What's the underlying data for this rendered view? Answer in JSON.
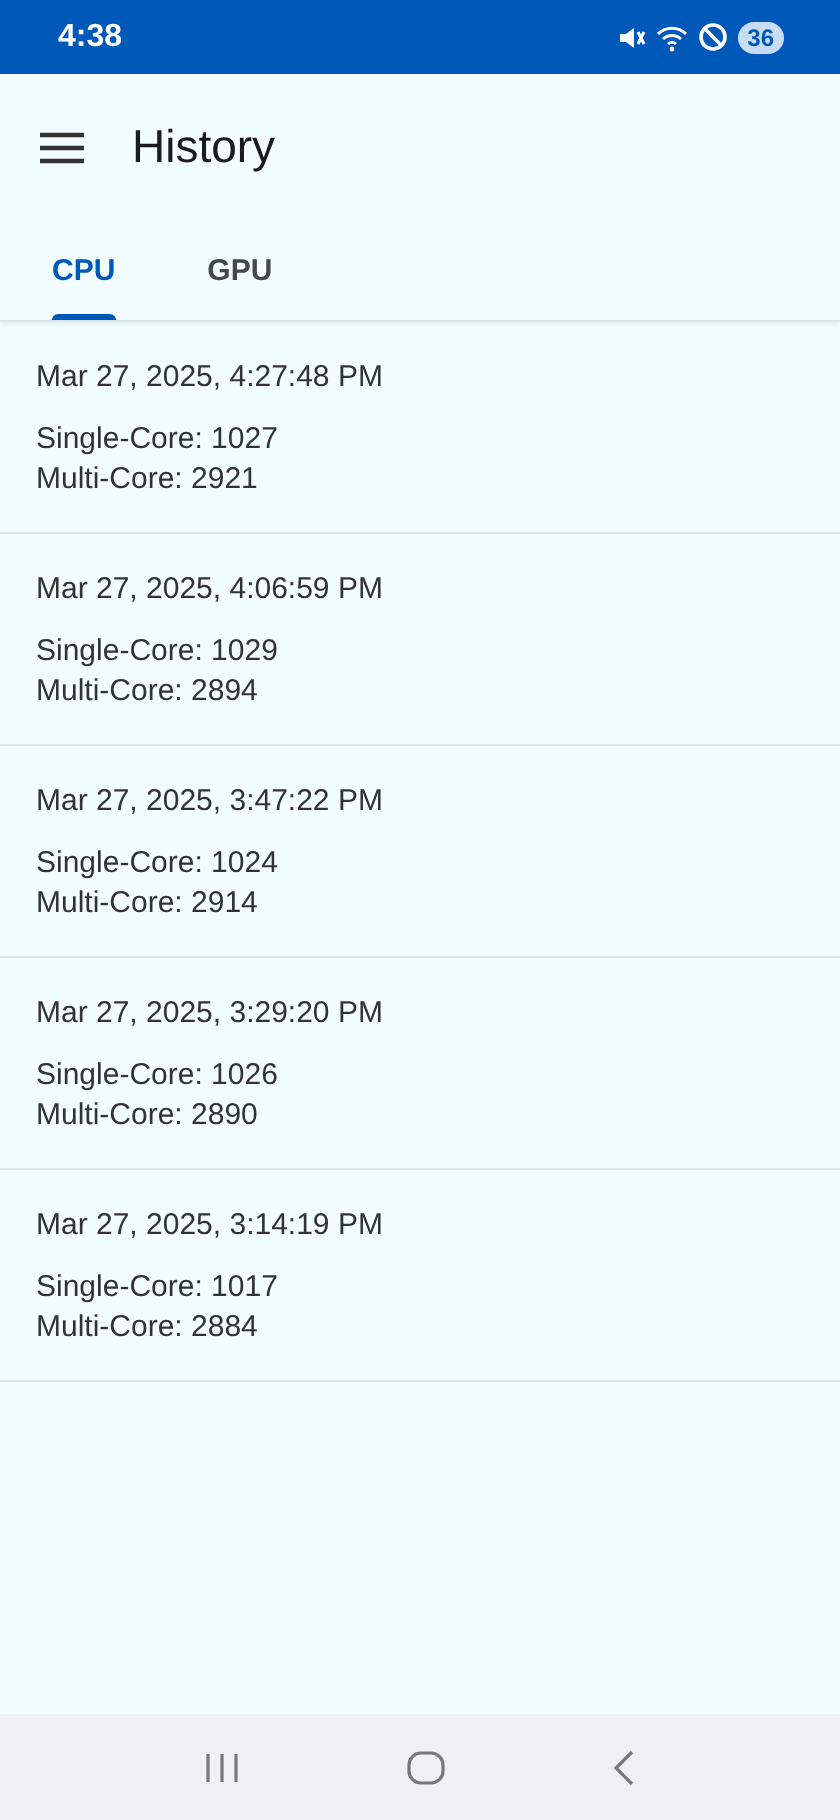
{
  "status_bar": {
    "time": "4:38",
    "battery": "36"
  },
  "app_bar": {
    "title": "History"
  },
  "tabs": [
    {
      "label": "CPU",
      "selected": true
    },
    {
      "label": "GPU",
      "selected": false
    }
  ],
  "results": [
    {
      "timestamp": "Mar 27, 2025, 4:27:48 PM",
      "single_core": "Single-Core: 1027",
      "multi_core": "Multi-Core: 2921"
    },
    {
      "timestamp": "Mar 27, 2025, 4:06:59 PM",
      "single_core": "Single-Core: 1029",
      "multi_core": "Multi-Core: 2894"
    },
    {
      "timestamp": "Mar 27, 2025, 3:47:22 PM",
      "single_core": "Single-Core: 1024",
      "multi_core": "Multi-Core: 2914"
    },
    {
      "timestamp": "Mar 27, 2025, 3:29:20 PM",
      "single_core": "Single-Core: 1026",
      "multi_core": "Multi-Core: 2890"
    },
    {
      "timestamp": "Mar 27, 2025, 3:14:19 PM",
      "single_core": "Single-Core: 1017",
      "multi_core": "Multi-Core: 2884"
    }
  ]
}
